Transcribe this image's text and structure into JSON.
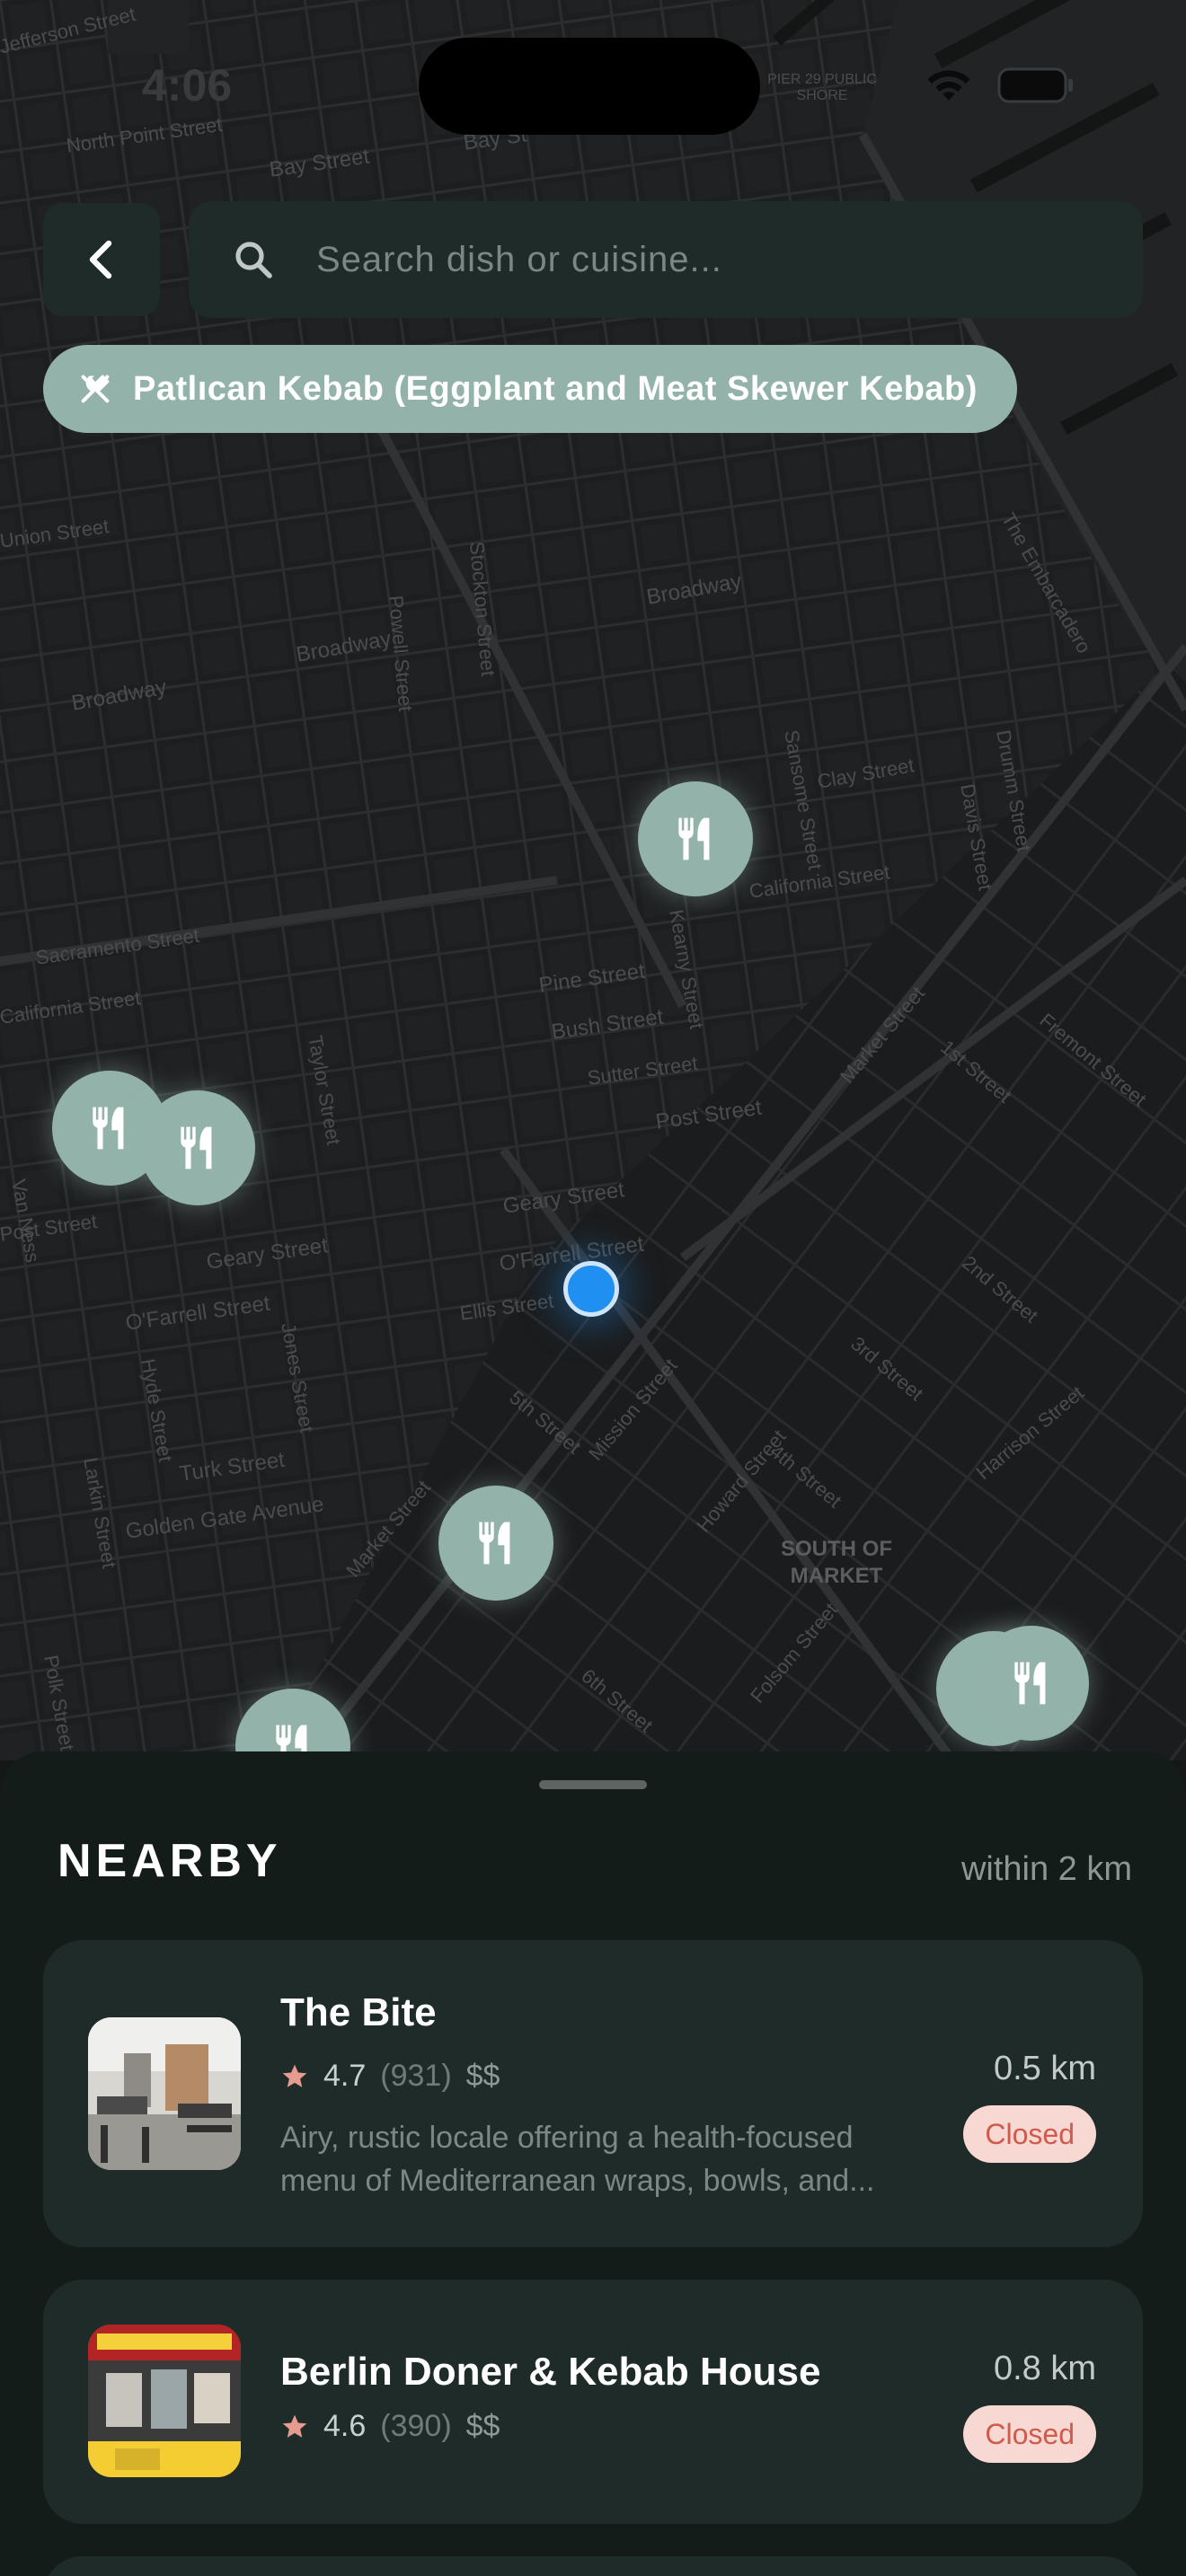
{
  "status_bar": {
    "time": "4:06"
  },
  "map": {
    "street_labels": [
      {
        "text": "Jefferson Street"
      },
      {
        "text": "North Point Street"
      },
      {
        "text": "Bay Street"
      },
      {
        "text": "Bay St"
      },
      {
        "text": "PIER 29 PUBLIC SHORE"
      },
      {
        "text": "Union Street"
      },
      {
        "text": "Broadway"
      },
      {
        "text": "Broadway"
      },
      {
        "text": "Broadway"
      },
      {
        "text": "Clay Street"
      },
      {
        "text": "California Street"
      },
      {
        "text": "Sacramento Street"
      },
      {
        "text": "California Street"
      },
      {
        "text": "Pine Street"
      },
      {
        "text": "Bush Street"
      },
      {
        "text": "Sutter Street"
      },
      {
        "text": "Post Street"
      },
      {
        "text": "Post Street"
      },
      {
        "text": "Geary Street"
      },
      {
        "text": "Geary Street"
      },
      {
        "text": "O'Farrell Street"
      },
      {
        "text": "O'Farrell Street"
      },
      {
        "text": "Ellis Street"
      },
      {
        "text": "Turk Street"
      },
      {
        "text": "Golden Gate Avenue"
      },
      {
        "text": "Mission Street"
      },
      {
        "text": "Howard Street"
      },
      {
        "text": "Market Street"
      },
      {
        "text": "Market Street"
      },
      {
        "text": "Stockton Street"
      },
      {
        "text": "Powell Street"
      },
      {
        "text": "Kearny Street"
      },
      {
        "text": "Taylor Street"
      },
      {
        "text": "Jones Street"
      },
      {
        "text": "Hyde Street"
      },
      {
        "text": "Larkin Street"
      },
      {
        "text": "Polk Street"
      },
      {
        "text": "Sansome Street"
      },
      {
        "text": "Davis Street"
      },
      {
        "text": "Drumm Street"
      },
      {
        "text": "The Embarcadero"
      },
      {
        "text": "1st Street"
      },
      {
        "text": "2nd Street"
      },
      {
        "text": "3rd Street"
      },
      {
        "text": "4th Street"
      },
      {
        "text": "5th Street"
      },
      {
        "text": "6th Street"
      },
      {
        "text": "Fremont Street"
      },
      {
        "text": "Harrison Street"
      },
      {
        "text": "Folsom Street"
      },
      {
        "text": "Van Ness"
      }
    ],
    "district_label": "SOUTH OF\nMARKET"
  },
  "search": {
    "placeholder": "Search dish or cuisine..."
  },
  "filter_chip": {
    "label": "Patlıcan Kebab (Eggplant and Meat Skewer Kebab)"
  },
  "sheet": {
    "title": "NEARBY",
    "range": "within 2 km",
    "restaurants": [
      {
        "name": "The Bite",
        "rating": "4.7",
        "reviews": "(931)",
        "price": "$$",
        "description_line1": "Airy, rustic locale offering a health-focused",
        "description_line2": "menu of Mediterranean wraps, bowls, and...",
        "distance": "0.5 km",
        "status": "Closed"
      },
      {
        "name": "Berlin Doner & Kebab House",
        "rating": "4.6",
        "reviews": "(390)",
        "price": "$$",
        "distance": "0.8 km",
        "status": "Closed"
      }
    ]
  },
  "colors": {
    "accent": "#93b3aa",
    "user_location": "#1f8ff0",
    "closed_badge_bg": "#f8d8d2",
    "closed_badge_text": "#d05a4c",
    "star": "#e79a8f"
  }
}
